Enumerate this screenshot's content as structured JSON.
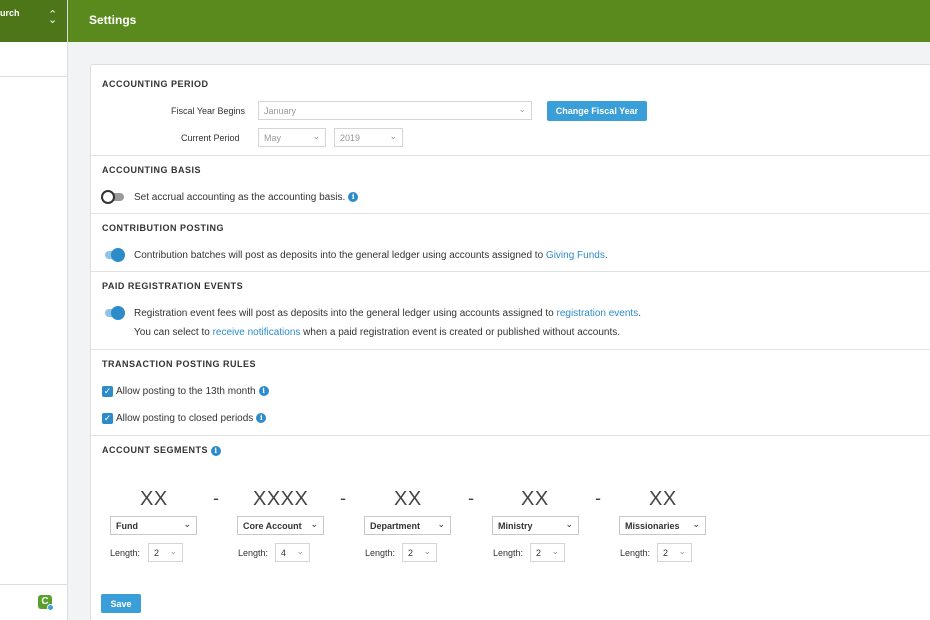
{
  "sidebar": {
    "org_name": "urch",
    "switch_icon": "chevron-up-down-icon",
    "bottom_icon": "app-logo-icon"
  },
  "header": {
    "title": "Settings"
  },
  "accounting_period": {
    "title": "ACCOUNTING PERIOD",
    "fiscal_year_label": "Fiscal Year Begins",
    "fiscal_year_value": "January",
    "change_button": "Change Fiscal Year",
    "current_period_label": "Current Period",
    "period_month": "May",
    "period_year": "2019"
  },
  "accounting_basis": {
    "title": "ACCOUNTING BASIS",
    "toggle_text": "Set accrual accounting as the accounting basis.",
    "enabled": false
  },
  "contribution_posting": {
    "title": "CONTRIBUTION POSTING",
    "text": "Contribution batches will post as deposits into the general ledger using accounts assigned to ",
    "link": "Giving Funds",
    "suffix": ".",
    "enabled": true
  },
  "paid_registration": {
    "title": "PAID REGISTRATION EVENTS",
    "text": "Registration event fees will post as deposits into the general ledger using accounts assigned to ",
    "link": "registration events",
    "suffix": ".",
    "line2_prefix": "You can select to ",
    "line2_link": "receive notifications",
    "line2_suffix": " when a paid registration event is created or published without accounts.",
    "enabled": true
  },
  "posting_rules": {
    "title": "TRANSACTION POSTING RULES",
    "rule1": "Allow posting to the 13th month",
    "rule2": "Allow posting to closed periods"
  },
  "account_segments": {
    "title": "ACCOUNT SEGMENTS",
    "dash": "-",
    "length_label": "Length:",
    "segments": [
      {
        "mask": "XX",
        "name": "Fund",
        "length": "2"
      },
      {
        "mask": "XXXX",
        "name": "Core Account",
        "length": "4"
      },
      {
        "mask": "XX",
        "name": "Department",
        "length": "2"
      },
      {
        "mask": "XX",
        "name": "Ministry",
        "length": "2"
      },
      {
        "mask": "XX",
        "name": "Missionaries",
        "length": "2"
      }
    ]
  },
  "save_button": "Save",
  "colors": {
    "header_green": "#5a8a1e",
    "accent_blue": "#3a9fd8",
    "link_blue": "#2e8bc9"
  }
}
